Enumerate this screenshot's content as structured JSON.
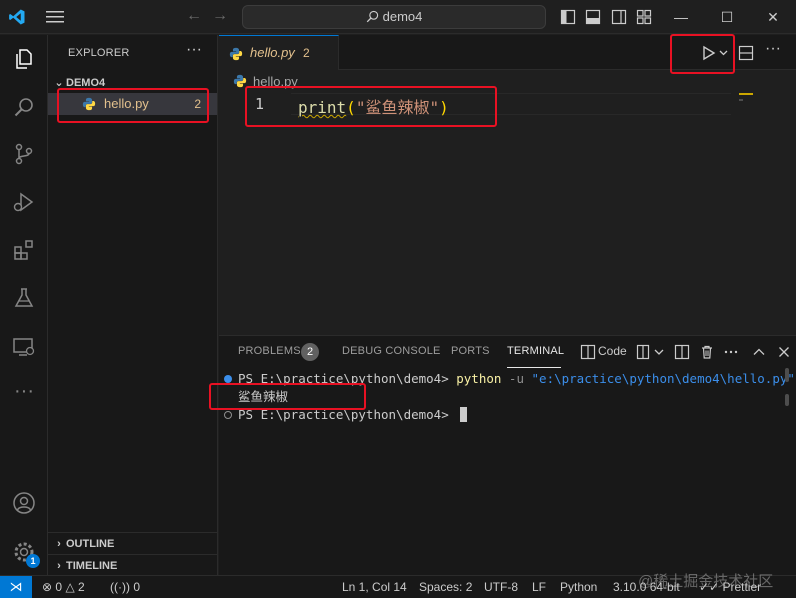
{
  "titlebar": {
    "search_text": "demo4",
    "minimize": "—",
    "maximize": "☐",
    "close": "✕"
  },
  "sidebar": {
    "title": "EXPLORER",
    "folder": "DEMO4",
    "file": {
      "name": "hello.py",
      "problems": "2"
    },
    "outline": "OUTLINE",
    "timeline": "TIMELINE"
  },
  "editor": {
    "tab": {
      "name": "hello.py",
      "problems": "2"
    },
    "breadcrumb": "hello.py",
    "line_number": "1",
    "code": {
      "fn": "print",
      "open": "(",
      "string": "\"鲨鱼辣椒\"",
      "close": ")"
    }
  },
  "panel": {
    "tabs": [
      "PROBLEMS",
      "DEBUG CONSOLE",
      "PORTS",
      "TERMINAL"
    ],
    "problems_badge": "2",
    "terminal_profile": "Code",
    "terminal": {
      "prompt1": "PS E:\\practice\\python\\demo4> ",
      "cmd": "python",
      "flag": " -u ",
      "path": "\"e:\\practice\\python\\demo4\\hello.py\"",
      "output": "鲨鱼辣椒",
      "prompt2": "PS E:\\practice\\python\\demo4> "
    }
  },
  "status": {
    "errors": "0",
    "warnings": "2",
    "ports": "0",
    "position": "Ln 1, Col 14",
    "spaces": "Spaces: 2",
    "encoding": "UTF-8",
    "eol": "LF",
    "language": "Python",
    "interpreter": "3.10.0 64-bit",
    "prettier": "Prettier",
    "accounts_badge": "1"
  },
  "watermark": "@稀土掘金技术社区",
  "colors": {
    "accent": "#0078d4",
    "highlight_box": "#e81123",
    "modified": "#e2c08d"
  }
}
